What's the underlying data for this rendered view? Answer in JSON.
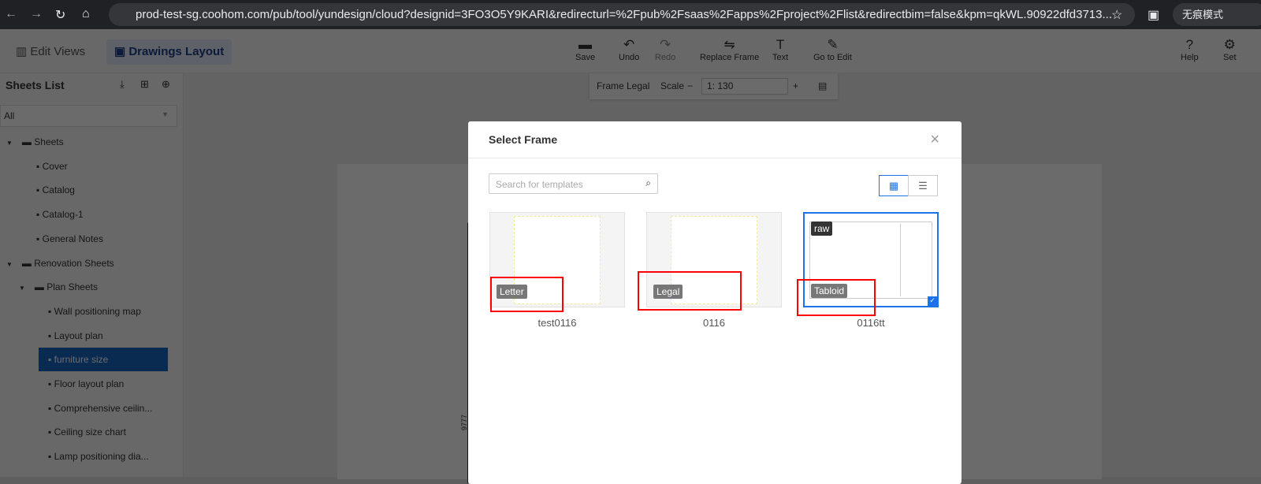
{
  "browser": {
    "url": "prod-test-sg.coohom.com/pub/tool/yundesign/cloud?designid=3FO3O5Y9KARI&redirecturl=%2Fpub%2Fsaas%2Fapps%2Fproject%2Flist&redirectbim=false&kpm=qkWL.90922dfd3713...",
    "profile": "无痕模式"
  },
  "toolbar": {
    "edit_views": "Edit Views",
    "drawings_layout": "Drawings Layout",
    "save": "Save",
    "undo": "Undo",
    "redo": "Redo",
    "replace_frame": "Replace Frame",
    "text": "Text",
    "go_to_edit": "Go to Edit",
    "help": "Help",
    "settings": "Set"
  },
  "framebar": {
    "frame": "Frame Legal",
    "scale_label": "Scale",
    "scale_value": "1: 130"
  },
  "sidebar": {
    "title": "Sheets List",
    "filter": "All",
    "items": [
      {
        "label": "Sheets",
        "type": "folder",
        "level": 0
      },
      {
        "label": "Cover",
        "type": "file",
        "level": 1
      },
      {
        "label": "Catalog",
        "type": "file",
        "level": 1
      },
      {
        "label": "Catalog-1",
        "type": "file",
        "level": 1
      },
      {
        "label": "General Notes",
        "type": "file",
        "level": 1
      },
      {
        "label": "Renovation Sheets",
        "type": "folder",
        "level": 0
      },
      {
        "label": "Plan Sheets",
        "type": "folder",
        "level": 1
      },
      {
        "label": "Wall positioning map",
        "type": "file",
        "level": 2
      },
      {
        "label": "Layout plan",
        "type": "file",
        "level": 2
      },
      {
        "label": "furniture size",
        "type": "file",
        "level": 2,
        "selected": true
      },
      {
        "label": "Floor layout plan",
        "type": "file",
        "level": 2
      },
      {
        "label": "Comprehensive ceilin...",
        "type": "file",
        "level": 2
      },
      {
        "label": "Ceiling size chart",
        "type": "file",
        "level": 2
      },
      {
        "label": "Lamp positioning dia...",
        "type": "file",
        "level": 2
      }
    ]
  },
  "canvas": {
    "dimension": "9777"
  },
  "modal": {
    "title": "Select Frame",
    "search_placeholder": "Search for templates",
    "cards": [
      {
        "tag": "Letter",
        "name": "test0116"
      },
      {
        "tag": "Legal",
        "name": "0116"
      },
      {
        "tag": "Tabloid",
        "name": "0116tt",
        "top_tag": "raw",
        "selected": true
      }
    ]
  },
  "colors": {
    "accent": "#1a73e8",
    "annotation": "#ff0000",
    "selected": "#1565c0"
  }
}
